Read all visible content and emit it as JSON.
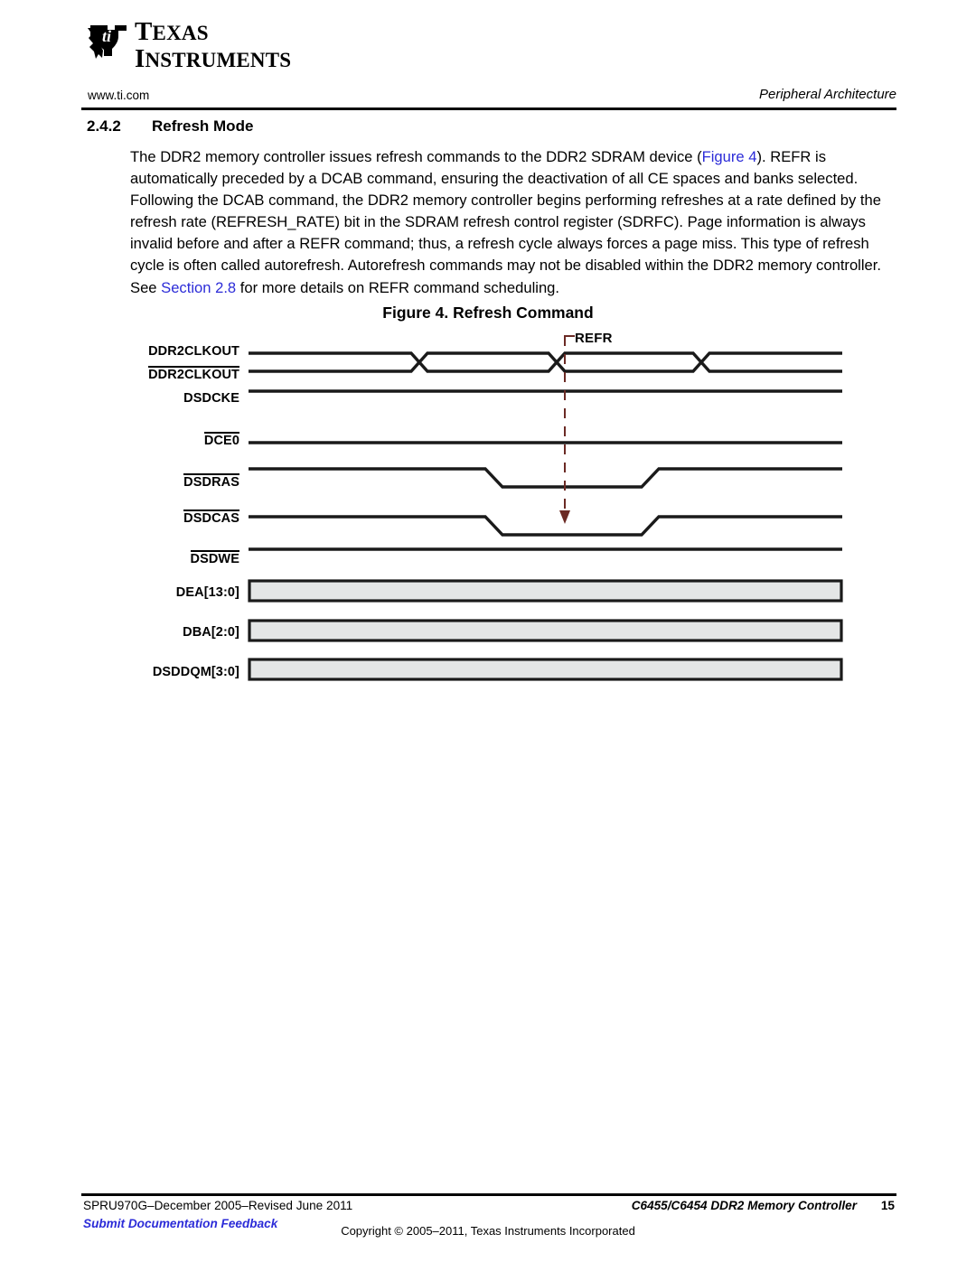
{
  "logo": {
    "line1": "Texas",
    "line2": "Instruments",
    "mark": "ti-logo-icon"
  },
  "header": {
    "url": "www.ti.com",
    "running_title": "Peripheral Architecture"
  },
  "section": {
    "number": "2.4.2",
    "title": "Refresh Mode"
  },
  "body": {
    "segments": [
      {
        "text": "The DDR2 memory controller issues refresh commands to the DDR2 SDRAM device (",
        "link": false
      },
      {
        "text": "Figure 4",
        "link": true
      },
      {
        "text": "). REFR is automatically preceded by a DCAB command, ensuring the deactivation of all CE spaces and banks selected. Following the DCAB command, the DDR2 memory controller begins performing refreshes at a rate defined by the refresh rate (REFRESH_RATE) bit in the SDRAM refresh control register (SDRFC). Page information is always invalid before and after a REFR command; thus, a refresh cycle always forces a page miss. This type of refresh cycle is often called autorefresh. Autorefresh commands may not be disabled within the DDR2 memory controller. See ",
        "link": false
      },
      {
        "text": "Section 2.8",
        "link": true
      },
      {
        "text": " for more details on REFR command scheduling.",
        "link": false
      }
    ]
  },
  "figure": {
    "caption": "Figure 4. Refresh Command",
    "annotation": "REFR",
    "signals": [
      {
        "name": "DDR2CLKOUT",
        "overbar": false,
        "type": "clock"
      },
      {
        "name": "DDR2CLKOUT",
        "overbar": true,
        "type": "clock"
      },
      {
        "name": "DSDCKE",
        "overbar": false,
        "type": "level-high"
      },
      {
        "name": "DCE0",
        "overbar": true,
        "type": "level-high"
      },
      {
        "name": "DSDRAS",
        "overbar": true,
        "type": "pulse-low"
      },
      {
        "name": "DSDCAS",
        "overbar": true,
        "type": "pulse-low"
      },
      {
        "name": "DSDWE",
        "overbar": true,
        "type": "level-high"
      },
      {
        "name": "DEA[13:0]",
        "overbar": false,
        "type": "bus"
      },
      {
        "name": "DBA[2:0]",
        "overbar": false,
        "type": "bus"
      },
      {
        "name": "DSDDQM[3:0]",
        "overbar": false,
        "type": "bus"
      }
    ],
    "colors": {
      "waveform": "#1a1a1a",
      "marker": "#6b2a24",
      "bus_fill": "#e4e6e6"
    }
  },
  "footer": {
    "doc_id": "SPRU970G–December 2005–Revised June 2011",
    "running_title": "C6455/C6454 DDR2 Memory Controller",
    "page_number": "15",
    "feedback_link": "Submit Documentation Feedback",
    "copyright": "Copyright © 2005–2011, Texas Instruments Incorporated"
  }
}
